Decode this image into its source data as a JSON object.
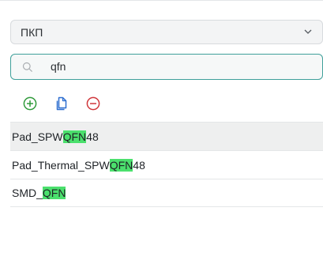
{
  "select": {
    "value": "ПКП"
  },
  "search": {
    "value": "qfn",
    "placeholder": ""
  },
  "toolbar": {
    "add": "add-icon",
    "copy": "copy-icon",
    "remove": "remove-icon"
  },
  "list": {
    "items": [
      {
        "prefix": "Pad_SPW",
        "match": "QFN",
        "suffix": "48"
      },
      {
        "prefix": "Pad_Thermal_SPW",
        "match": "QFN",
        "suffix": "48"
      },
      {
        "prefix": "SMD_",
        "match": "QFN",
        "suffix": ""
      }
    ]
  },
  "colors": {
    "accent": "#3fa09a",
    "highlight": "#4be06d",
    "add": "#2f9a3a",
    "copy": "#2e6fd0",
    "remove": "#d0363a"
  }
}
